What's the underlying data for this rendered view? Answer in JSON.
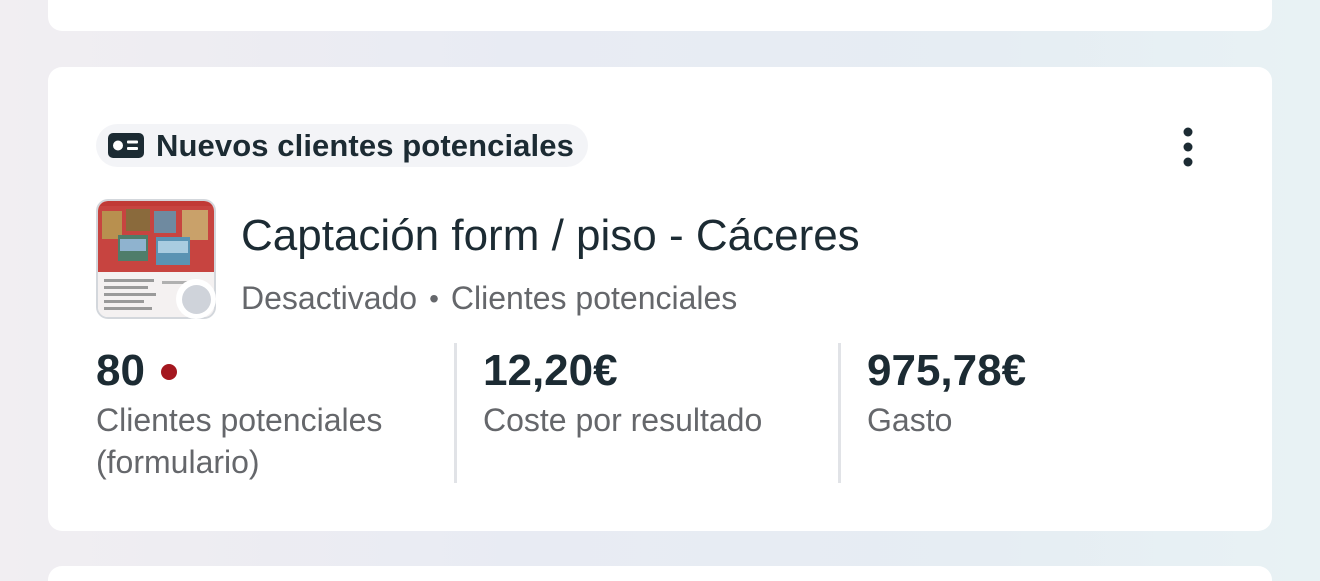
{
  "objective": {
    "label": "Nuevos clientes potenciales",
    "icon": "lead-form-icon"
  },
  "more_options": {
    "icon": "more-vertical-icon"
  },
  "ad": {
    "title": "Captación form / piso - Cáceres",
    "status": "Desactivado",
    "separator": "•",
    "result_type": "Clientes potenciales",
    "status_color": "#cfd3da"
  },
  "metrics": [
    {
      "value": "80",
      "label": "Clientes potenciales (formulario)",
      "alert_color": "#a4171f"
    },
    {
      "value": "12,20€",
      "label": "Coste por resultado"
    },
    {
      "value": "975,78€",
      "label": "Gasto"
    }
  ],
  "colors": {
    "text_primary": "#1c2b33",
    "text_secondary": "#65676b",
    "card": "#ffffff"
  }
}
